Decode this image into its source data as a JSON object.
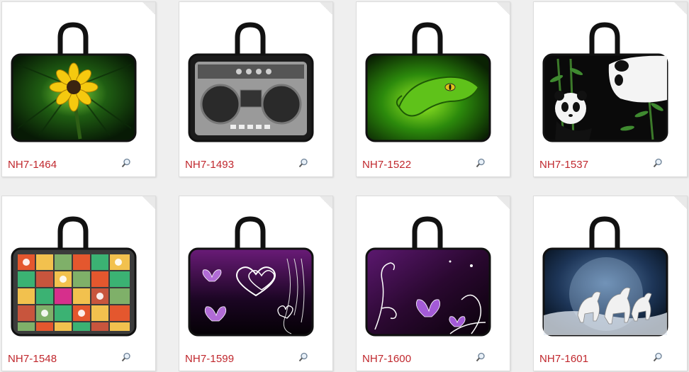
{
  "products": [
    {
      "code": "NH7-1464",
      "design": "sunflower",
      "zoom_icon": "magnifier-icon"
    },
    {
      "code": "NH7-1493",
      "design": "boombox",
      "zoom_icon": "magnifier-icon"
    },
    {
      "code": "NH7-1522",
      "design": "green-snake",
      "zoom_icon": "magnifier-icon"
    },
    {
      "code": "NH7-1537",
      "design": "pandas-bamboo",
      "zoom_icon": "magnifier-icon"
    },
    {
      "code": "NH7-1548",
      "design": "retro-tiles",
      "zoom_icon": "magnifier-icon"
    },
    {
      "code": "NH7-1599",
      "design": "purple-hearts-butterflies",
      "zoom_icon": "magnifier-icon"
    },
    {
      "code": "NH7-1600",
      "design": "purple-swirls-butterflies",
      "zoom_icon": "magnifier-icon"
    },
    {
      "code": "NH7-1601",
      "design": "white-horses-moon",
      "zoom_icon": "magnifier-icon"
    }
  ],
  "colors": {
    "code_text": "#c0272d",
    "background": "#efefef",
    "card": "#ffffff"
  }
}
